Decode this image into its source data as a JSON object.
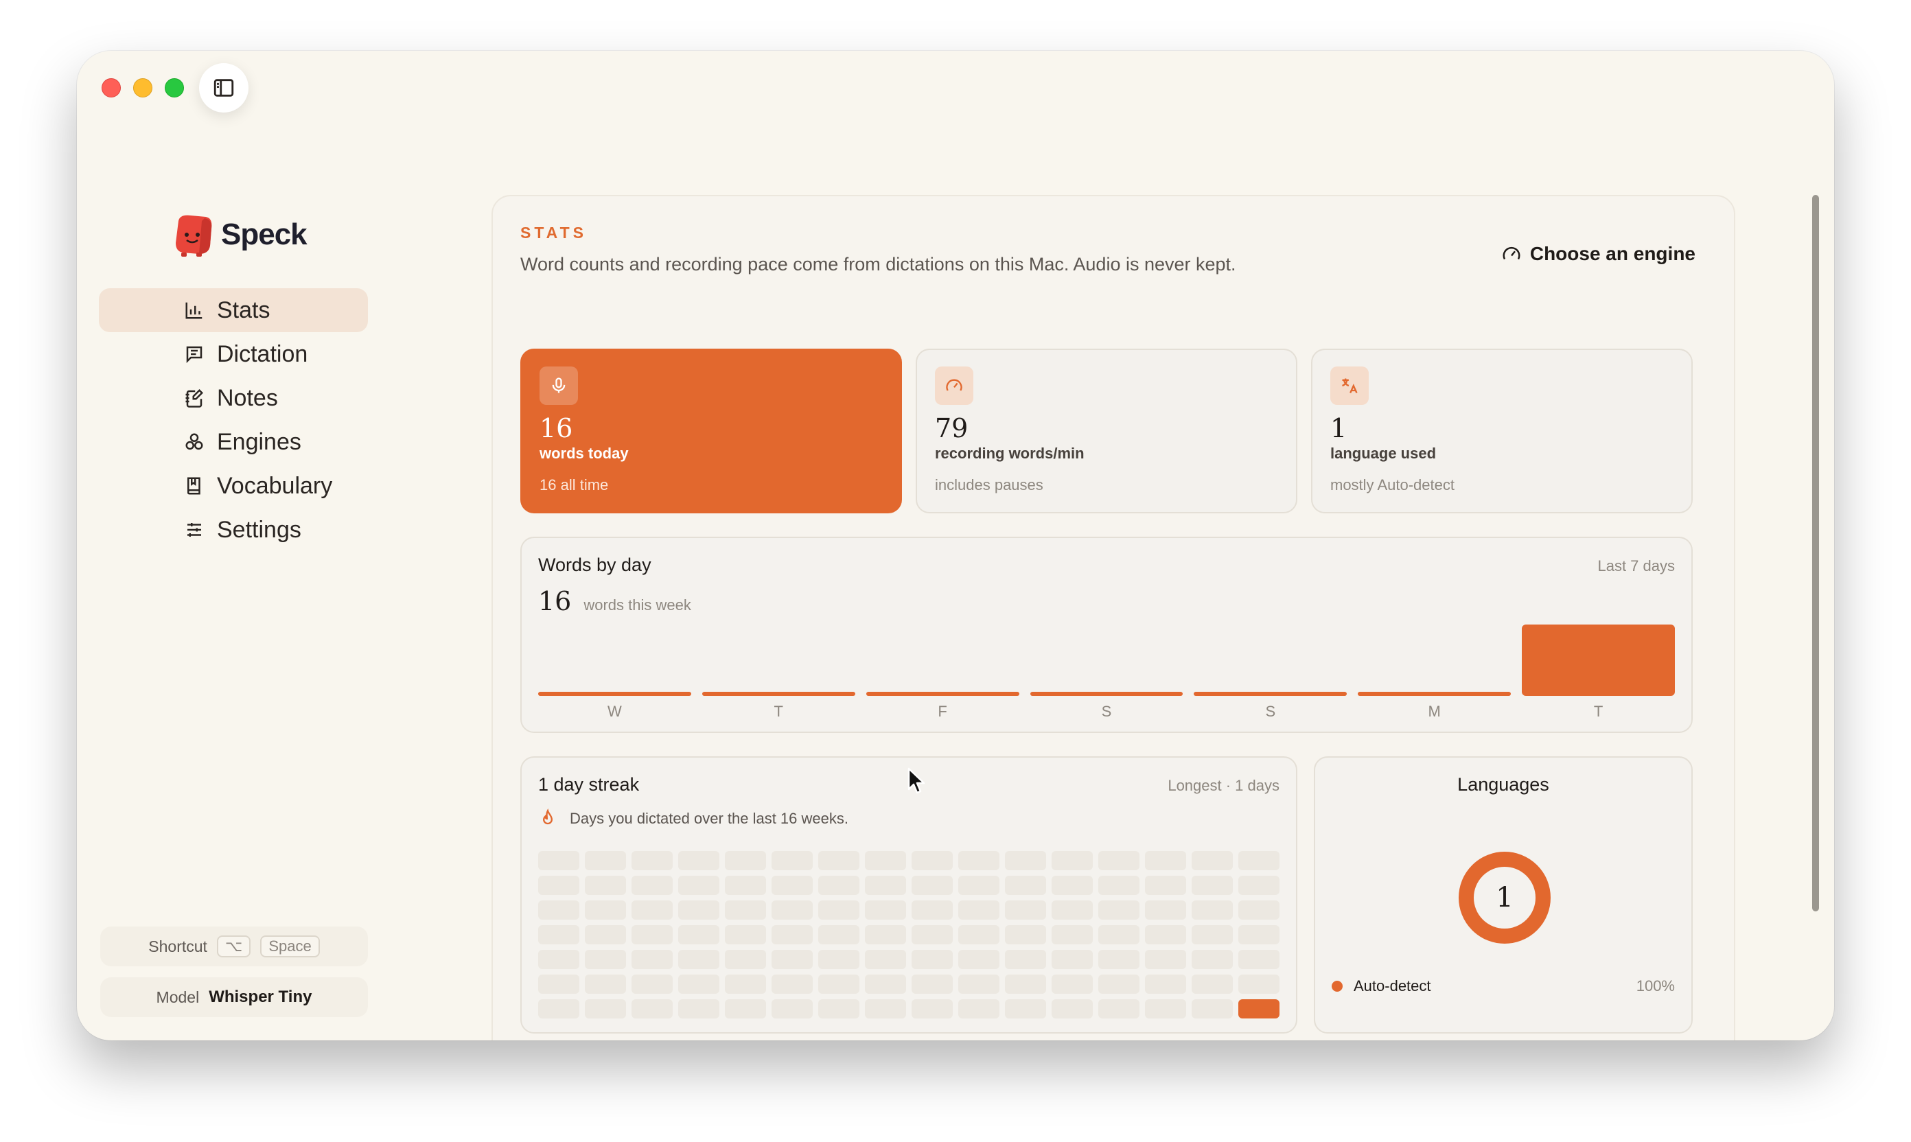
{
  "app": {
    "name": "Speck"
  },
  "colors": {
    "accent": "#e2682e",
    "accent_soft": "#f5dccb",
    "background": "#f9f6ee"
  },
  "sidebar": {
    "items": [
      {
        "label": "Stats",
        "icon": "bar-chart-icon",
        "active": true
      },
      {
        "label": "Dictation",
        "icon": "message-square-icon",
        "active": false
      },
      {
        "label": "Notes",
        "icon": "notebook-pen-icon",
        "active": false
      },
      {
        "label": "Engines",
        "icon": "cog-cluster-icon",
        "active": false
      },
      {
        "label": "Vocabulary",
        "icon": "book-icon",
        "active": false
      },
      {
        "label": "Settings",
        "icon": "sliders-icon",
        "active": false
      }
    ],
    "shortcut": {
      "label": "Shortcut",
      "key_modifier": "⌥",
      "key": "Space"
    },
    "model": {
      "label": "Model",
      "value": "Whisper Tiny"
    }
  },
  "header": {
    "eyebrow": "STATS",
    "subtitle": "Word counts and recording pace come from dictations on this Mac. Audio is never kept.",
    "engine_link": "Choose an engine"
  },
  "stats": [
    {
      "value": "16",
      "label": "words today",
      "sub": "16 all time",
      "icon": "microphone-icon"
    },
    {
      "value": "79",
      "label": "recording words/min",
      "sub": "includes pauses",
      "icon": "gauge-icon"
    },
    {
      "value": "1",
      "label": "language used",
      "sub": "mostly Auto-detect",
      "icon": "translate-icon"
    }
  ],
  "words_by_day": {
    "title": "Words by day",
    "meta": "Last 7 days",
    "total": "16",
    "total_label": "words this week"
  },
  "chart_data": {
    "type": "bar",
    "categories": [
      "W",
      "T",
      "F",
      "S",
      "S",
      "M",
      "T"
    ],
    "values": [
      0,
      0,
      0,
      0,
      0,
      0,
      16
    ]
  },
  "streak": {
    "title": "1 day streak",
    "meta": "Longest · 1 days",
    "description": "Days you dictated over the last 16 weeks.",
    "weeks": 16,
    "days": 7,
    "active_cells": [
      [
        15,
        6
      ]
    ]
  },
  "languages": {
    "title": "Languages",
    "count": "1",
    "items": [
      {
        "name": "Auto-detect",
        "percent": "100%"
      }
    ]
  }
}
